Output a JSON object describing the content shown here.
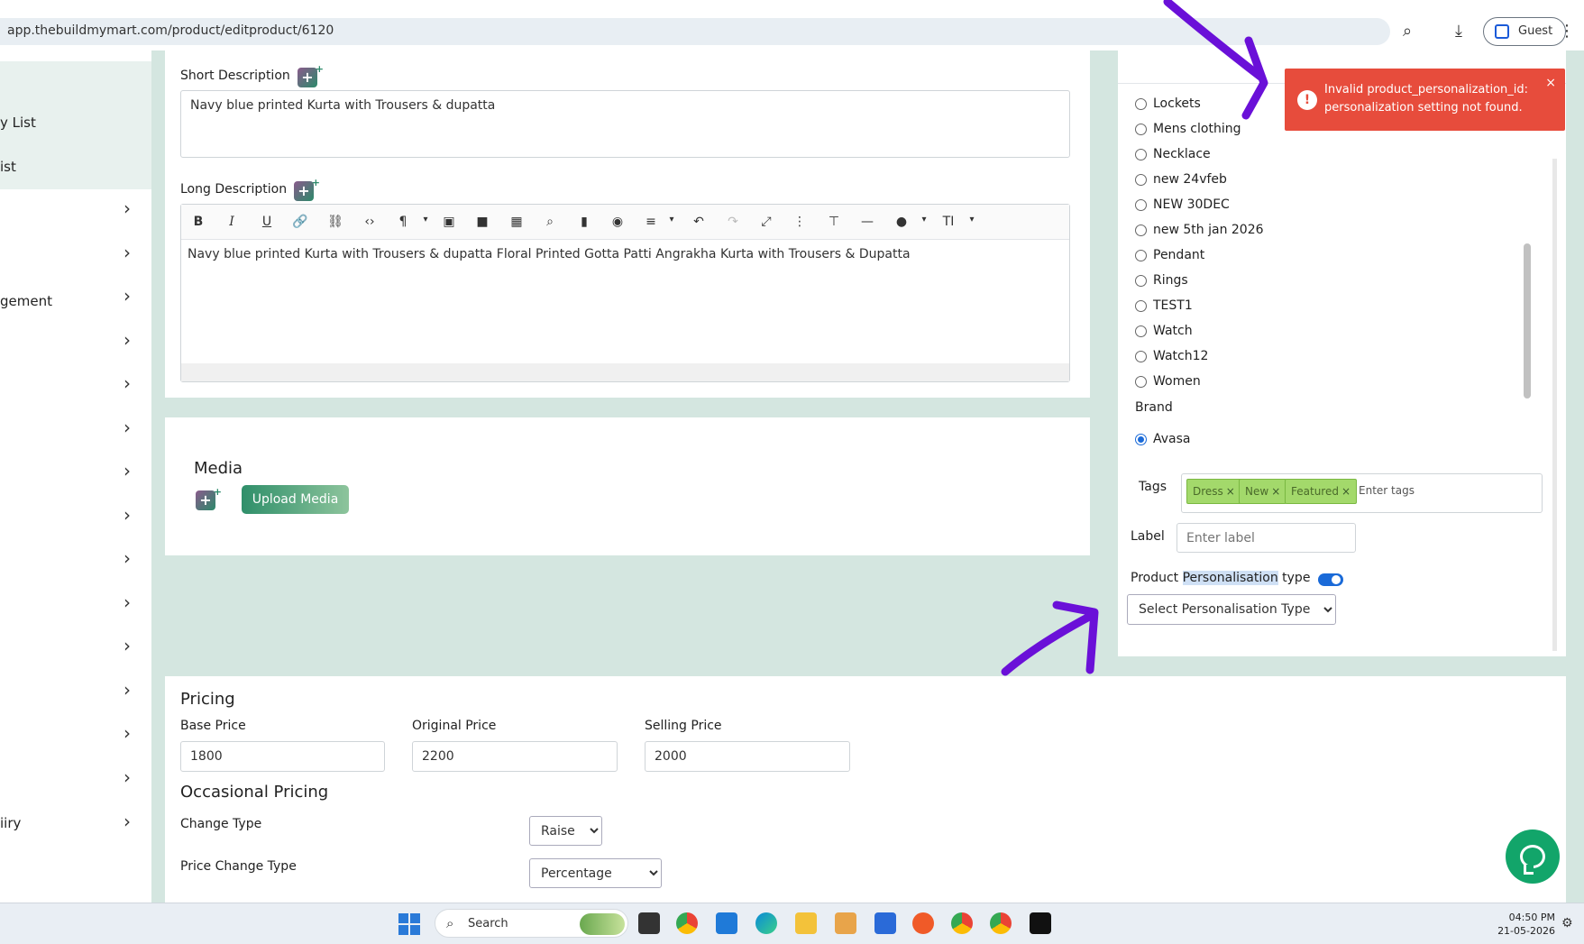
{
  "browser": {
    "url": "app.thebuildmymart.com/product/editproduct/6120",
    "guest_label": "Guest"
  },
  "sidebar": {
    "items": [
      {
        "label": "y List"
      },
      {
        "label": "ist"
      },
      {
        "label": "gement"
      },
      {
        "label": "iiry"
      }
    ],
    "chevron": "›"
  },
  "short_description": {
    "label": "Short Description",
    "value": "Navy blue printed Kurta with Trousers & dupatta"
  },
  "long_description": {
    "label": "Long Description",
    "value": "Navy blue printed Kurta with Trousers & dupatta Floral Printed Gotta Patti Angrakha Kurta with Trousers & Dupatta"
  },
  "media": {
    "title": "Media",
    "upload_label": "Upload Media"
  },
  "categories": [
    {
      "label": "Lockets"
    },
    {
      "label": "Mens clothing"
    },
    {
      "label": "Necklace"
    },
    {
      "label": "new 24vfeb"
    },
    {
      "label": "NEW 30DEC"
    },
    {
      "label": "new 5th jan 2026"
    },
    {
      "label": "Pendant"
    },
    {
      "label": "Rings"
    },
    {
      "label": "TEST1"
    },
    {
      "label": "Watch"
    },
    {
      "label": "Watch12"
    },
    {
      "label": "Women"
    }
  ],
  "brand": {
    "label": "Brand",
    "selected": "Avasa"
  },
  "tags": {
    "label": "Tags",
    "items": [
      "Dress",
      "New",
      "Featured"
    ],
    "remove_glyph": "×",
    "placeholder": "Enter tags"
  },
  "label_field": {
    "label": "Label",
    "placeholder": "Enter label"
  },
  "personalisation": {
    "label_prefix": "Product ",
    "label_highlight": "Personalisation",
    "label_suffix": " type",
    "select_value": "Select Personalisation Type"
  },
  "toast": {
    "message_line1": "Invalid product_personalization_id:",
    "message_line2": "personalization setting not found.",
    "close": "×",
    "icon": "!"
  },
  "pricing": {
    "title": "Pricing",
    "base_label": "Base Price",
    "base_value": "1800",
    "original_label": "Original Price",
    "original_value": "2200",
    "selling_label": "Selling Price",
    "selling_value": "2000"
  },
  "occasional": {
    "title": "Occasional Pricing",
    "change_type_label": "Change Type",
    "change_type_value": "Raise",
    "price_change_type_label": "Price Change Type",
    "price_change_type_value": "Percentage"
  },
  "taskbar": {
    "search_label": "Search",
    "time": "04:50 PM",
    "date": "21-05-2026"
  },
  "colors": {
    "accent": "#2f8f6a",
    "toast": "#e74c3c",
    "arrow": "#6a10d8",
    "toggle": "#1a6ad8"
  }
}
